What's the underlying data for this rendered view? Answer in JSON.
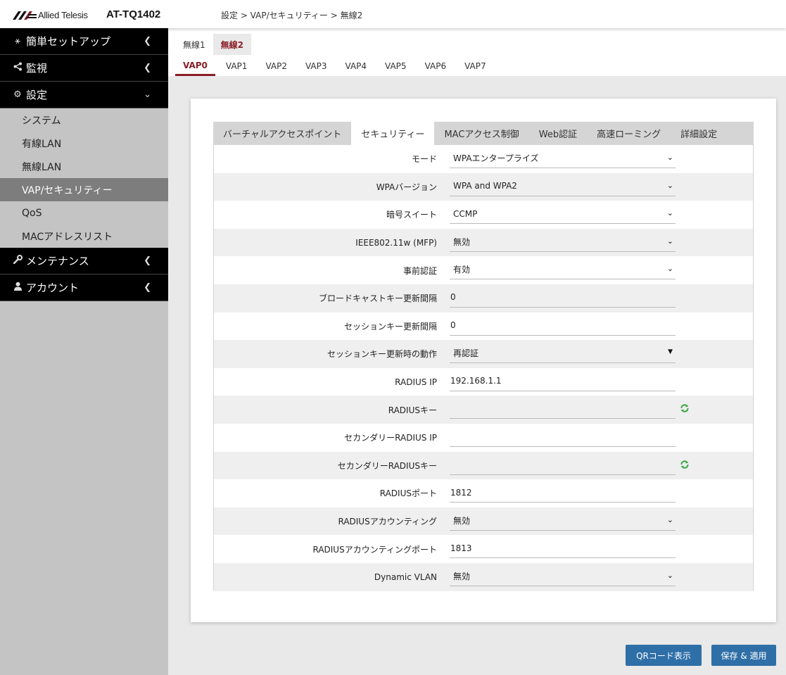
{
  "header": {
    "brand": "Allied Telesis",
    "model": "AT-TQ1402",
    "breadcrumb": "設定 > VAP/セキュリティー > 無線2"
  },
  "sidebar": {
    "sections": [
      {
        "label": "簡単セットアップ",
        "icon": "wand-icon",
        "chevron": "chevron-left-icon"
      },
      {
        "label": "監視",
        "icon": "share-icon",
        "chevron": "chevron-left-icon"
      },
      {
        "label": "設定",
        "icon": "gear-icon",
        "chevron": "chevron-down-icon"
      },
      {
        "label": "メンテナンス",
        "icon": "wrench-icon",
        "chevron": "chevron-left-icon"
      },
      {
        "label": "アカウント",
        "icon": "user-icon",
        "chevron": "chevron-left-icon"
      }
    ],
    "settings_items": [
      "システム",
      "有線LAN",
      "無線LAN",
      "VAP/セキュリティー",
      "QoS",
      "MACアドレスリスト"
    ],
    "active_item": "VAP/セキュリティー"
  },
  "radio_tabs": [
    "無線1",
    "無線2"
  ],
  "active_radio": "無線2",
  "vap_tabs": [
    "VAP0",
    "VAP1",
    "VAP2",
    "VAP3",
    "VAP4",
    "VAP5",
    "VAP6",
    "VAP7"
  ],
  "active_vap": "VAP0",
  "inner_tabs": [
    "バーチャルアクセスポイント",
    "セキュリティー",
    "MACアクセス制御",
    "Web認証",
    "高速ローミング",
    "詳細設定"
  ],
  "active_inner_tab": "セキュリティー",
  "form": {
    "mode": {
      "label": "モード",
      "value": "WPAエンタープライズ"
    },
    "wpa_version": {
      "label": "WPAバージョン",
      "value": "WPA and WPA2"
    },
    "cipher_suite": {
      "label": "暗号スイート",
      "value": "CCMP"
    },
    "mfp": {
      "label": "IEEE802.11w (MFP)",
      "value": "無効"
    },
    "preauth": {
      "label": "事前認証",
      "value": "有効"
    },
    "broadcast_key_interval": {
      "label": "ブロードキャストキー更新間隔",
      "value": "0"
    },
    "session_key_interval": {
      "label": "セッションキー更新間隔",
      "value": "0"
    },
    "session_key_action": {
      "label": "セッションキー更新時の動作",
      "value": "再認証"
    },
    "radius_ip": {
      "label": "RADIUS IP",
      "value": "192.168.1.1"
    },
    "radius_key": {
      "label": "RADIUSキー",
      "value": ""
    },
    "secondary_radius_ip": {
      "label": "セカンダリーRADIUS IP",
      "value": ""
    },
    "secondary_radius_key": {
      "label": "セカンダリーRADIUSキー",
      "value": ""
    },
    "radius_port": {
      "label": "RADIUSポート",
      "value": "1812"
    },
    "radius_accounting": {
      "label": "RADIUSアカウンティング",
      "value": "無効"
    },
    "radius_accounting_port": {
      "label": "RADIUSアカウンティングポート",
      "value": "1813"
    },
    "dynamic_vlan": {
      "label": "Dynamic VLAN",
      "value": "無効"
    }
  },
  "buttons": {
    "qr": "QRコード表示",
    "save": "保存 & 適用"
  },
  "colors": {
    "accent": "#8a1f28",
    "button": "#2f6fa7",
    "sidebar_bg": "#c4c4c4",
    "nav_bg": "#000000",
    "refresh_icon": "#3aa845"
  }
}
